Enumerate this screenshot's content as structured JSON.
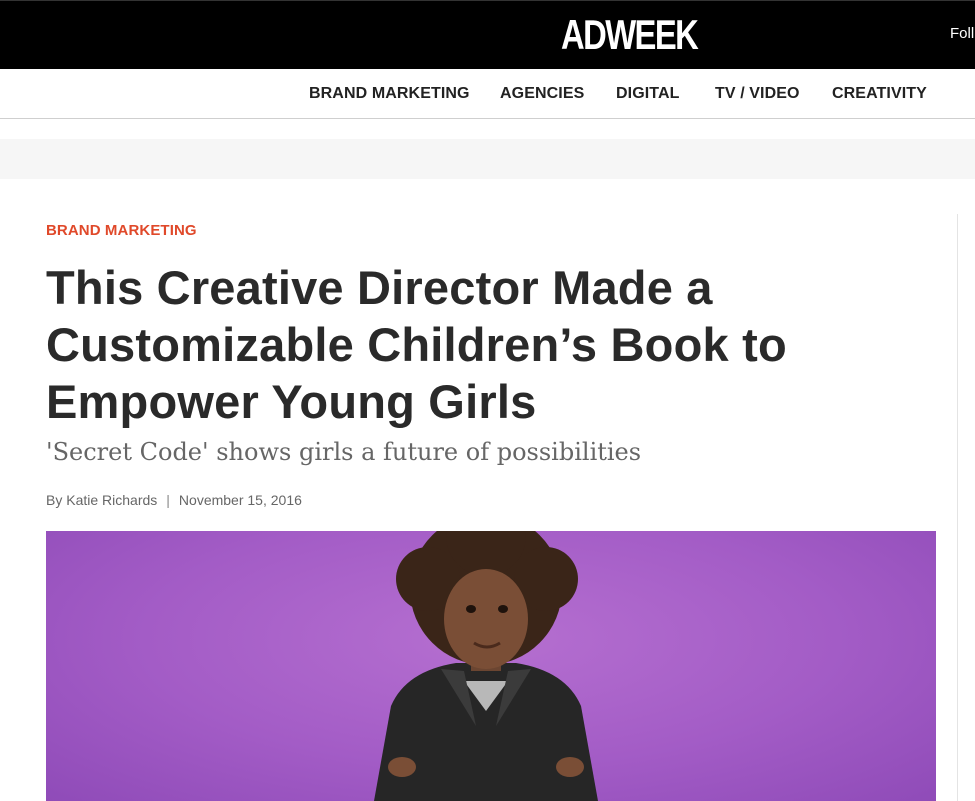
{
  "header": {
    "logo": "ADWEEK",
    "follow_label": "Foll"
  },
  "nav": {
    "items": [
      {
        "label": "BRAND MARKETING"
      },
      {
        "label": "AGENCIES"
      },
      {
        "label": "DIGITAL"
      },
      {
        "label": "TV / VIDEO"
      },
      {
        "label": "CREATIVITY"
      }
    ]
  },
  "article": {
    "category": "BRAND MARKETING",
    "headline": "This Creative Director Made a Customizable Children’s Book to Empower Young Girls",
    "dek": "'Secret Code' shows girls a future of possibilities",
    "author": "By Katie Richards",
    "separator": "|",
    "date": "November 15, 2016"
  },
  "colors": {
    "topbar": "#000000",
    "category": "#e0492a",
    "hero_background": "#a35cc6"
  }
}
